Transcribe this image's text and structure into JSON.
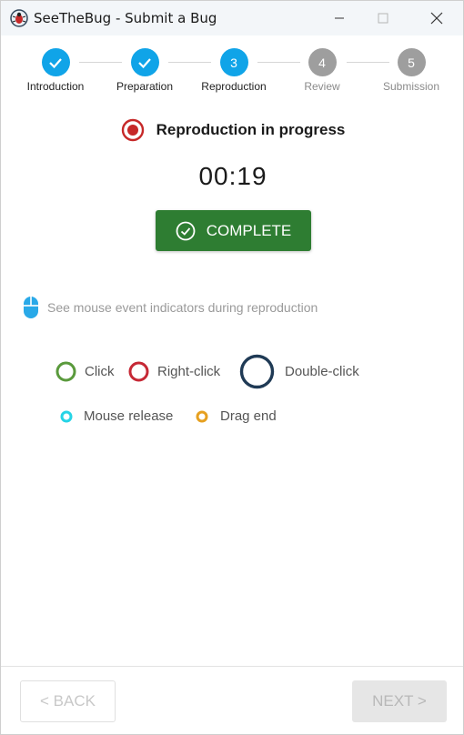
{
  "window": {
    "title": "SeeTheBug - Submit a Bug",
    "icon": "bug-icon"
  },
  "stepper": {
    "steps": [
      {
        "number": "1",
        "label": "Introduction",
        "state": "done"
      },
      {
        "number": "2",
        "label": "Preparation",
        "state": "done"
      },
      {
        "number": "3",
        "label": "Reproduction",
        "state": "active"
      },
      {
        "number": "4",
        "label": "Review",
        "state": "pending"
      },
      {
        "number": "5",
        "label": "Submission",
        "state": "pending"
      }
    ]
  },
  "recording": {
    "status_text": "Reproduction in progress",
    "timer": "00:19",
    "complete_label": "COMPLETE"
  },
  "hint": {
    "text": "See mouse event indicators during reproduction",
    "icon": "mouse-icon"
  },
  "legend": {
    "click": "Click",
    "right_click": "Right-click",
    "double_click": "Double-click",
    "mouse_release": "Mouse release",
    "drag_end": "Drag end"
  },
  "footer": {
    "back_label": "< BACK",
    "next_label": "NEXT >"
  },
  "colors": {
    "accent": "#10a4e8",
    "complete_green": "#2e7d32",
    "record_red": "#c62828",
    "pending_gray": "#9e9e9e",
    "click_green": "#5a9a3c",
    "right_click_red": "#c62835",
    "double_click_navy": "#1f3a55",
    "mouse_release_cyan": "#26d4e6",
    "drag_end_orange": "#e6a020"
  }
}
